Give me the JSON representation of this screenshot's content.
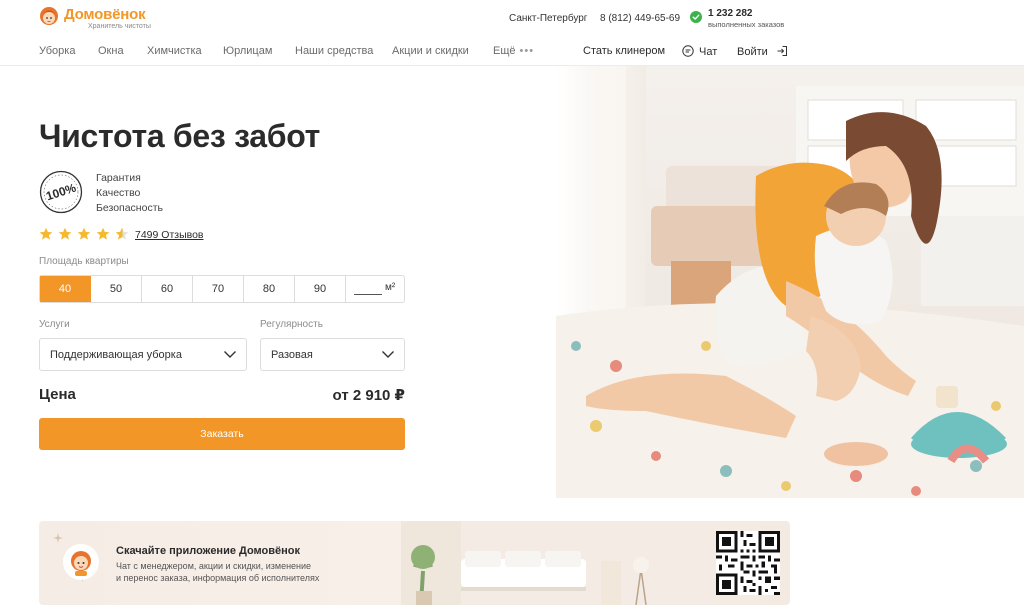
{
  "header": {
    "logo_name": "Домовёнок",
    "logo_tagline": "Хранитель чистоты",
    "city": "Санкт-Петербург",
    "phone": "8 (812) 449-65-69",
    "orders_count": "1 232 282",
    "orders_label": "выполненных заказов"
  },
  "nav": {
    "items": [
      "Уборка",
      "Окна",
      "Химчистка",
      "Юрлицам",
      "Наши средства",
      "Акции и скидки",
      "Ещё"
    ],
    "more_dots": "•••",
    "become_cleaner": "Стать клинером",
    "chat": "Чат",
    "login": "Войти"
  },
  "hero": {
    "title": "Чистота без забот",
    "badge": "100%",
    "features": [
      "Гарантия",
      "Качество",
      "Безопасность"
    ],
    "rating": 4.5,
    "reviews": "7499 Отзывов"
  },
  "calculator": {
    "area_label": "Площадь квартиры",
    "area_options": [
      "40",
      "50",
      "60",
      "70",
      "80",
      "90"
    ],
    "area_selected": "40",
    "area_unit": "м²",
    "services_label": "Услуги",
    "services_value": "Поддерживающая уборка",
    "regularity_label": "Регулярность",
    "regularity_value": "Разовая",
    "price_label": "Цена",
    "price_value": "от 2 910 ₽",
    "order_button": "Заказать"
  },
  "app_banner": {
    "title": "Скачайте приложение Домовёнок",
    "desc_line1": "Чат с менеджером, акции и скидки, изменение",
    "desc_line2": "и перенос заказа, информация об исполнителях"
  },
  "colors": {
    "accent": "#f29727",
    "star": "#f5b82e",
    "text": "#2b2b2b",
    "check_green": "#3ab34a"
  }
}
